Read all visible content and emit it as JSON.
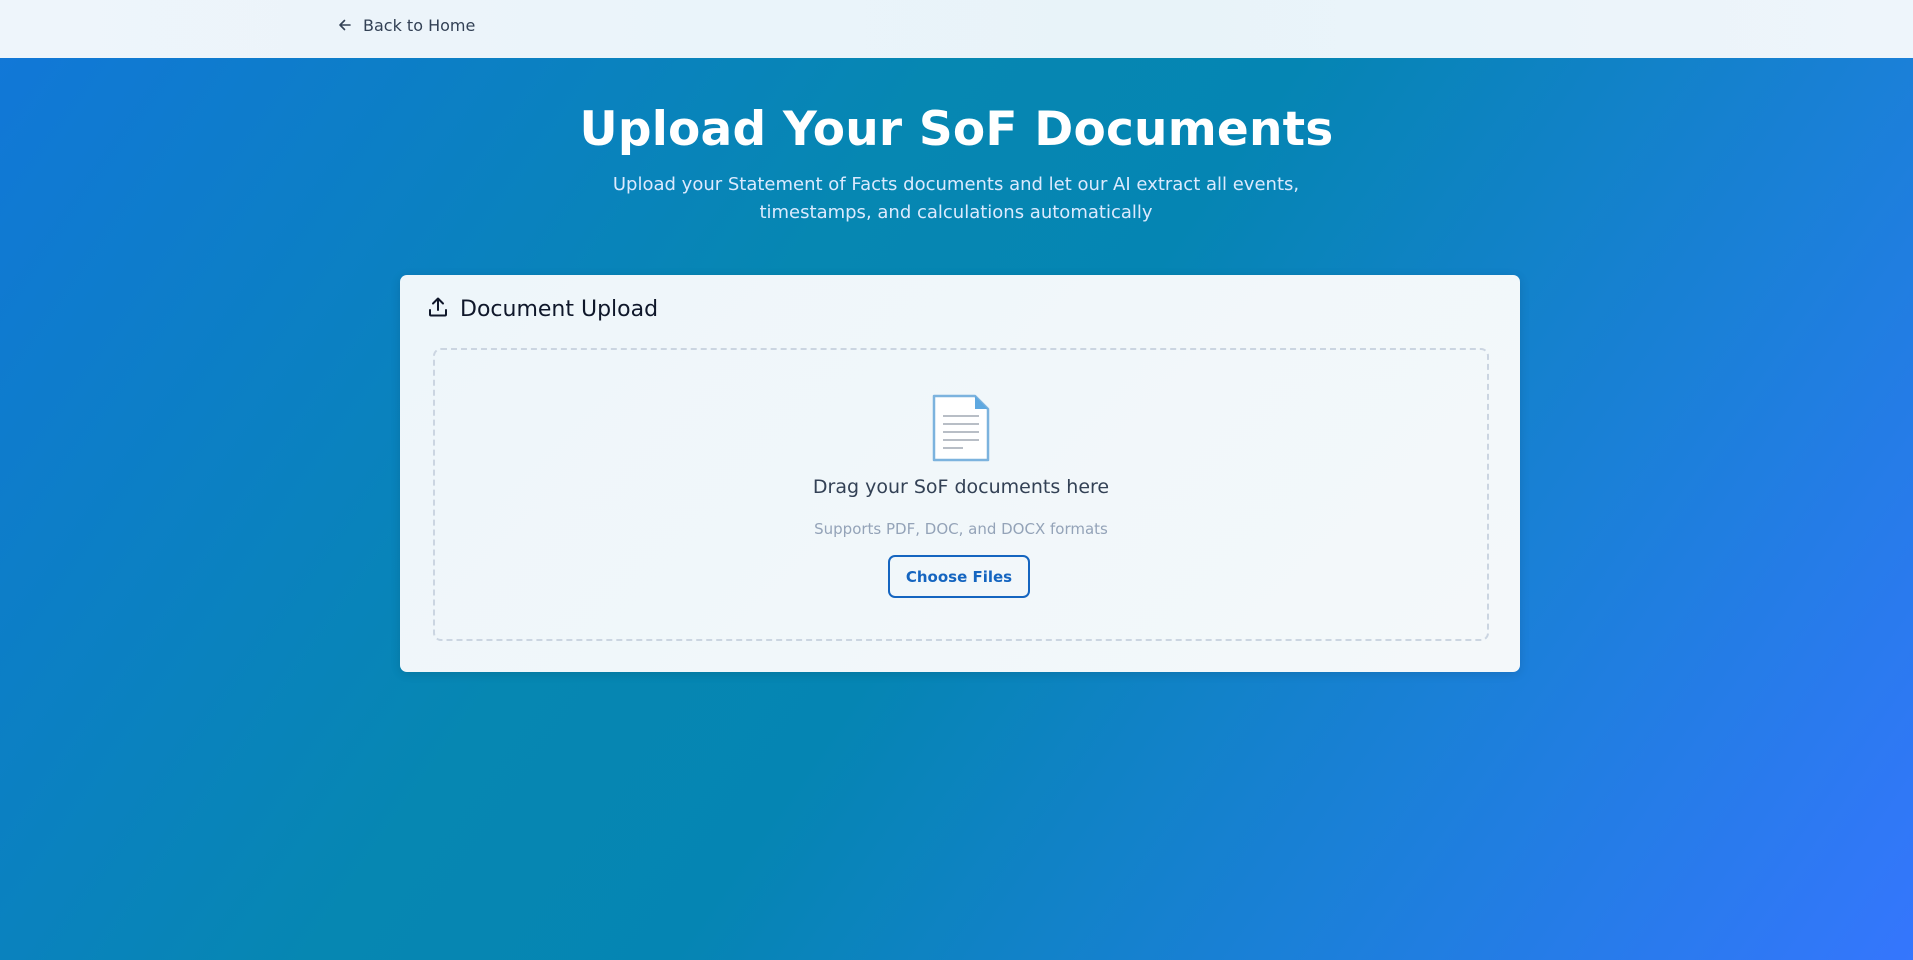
{
  "nav": {
    "back_label": "Back to Home",
    "back_icon": "arrow-left-icon"
  },
  "hero": {
    "title": "Upload Your SoF Documents",
    "subtitle": "Upload your Statement of Facts documents and let our AI extract all events, timestamps, and calculations automatically"
  },
  "upload_card": {
    "title": "Document Upload",
    "title_icon": "upload-icon",
    "dropzone": {
      "icon": "document-icon",
      "heading": "Drag your SoF documents here",
      "formats_text": "Supports PDF, DOC, and DOCX formats",
      "button_label": "Choose Files"
    }
  },
  "colors": {
    "accent": "#1565c0",
    "background_start": "#1277d9",
    "background_end": "#3576fd",
    "card_background": "#f1f7fa"
  }
}
